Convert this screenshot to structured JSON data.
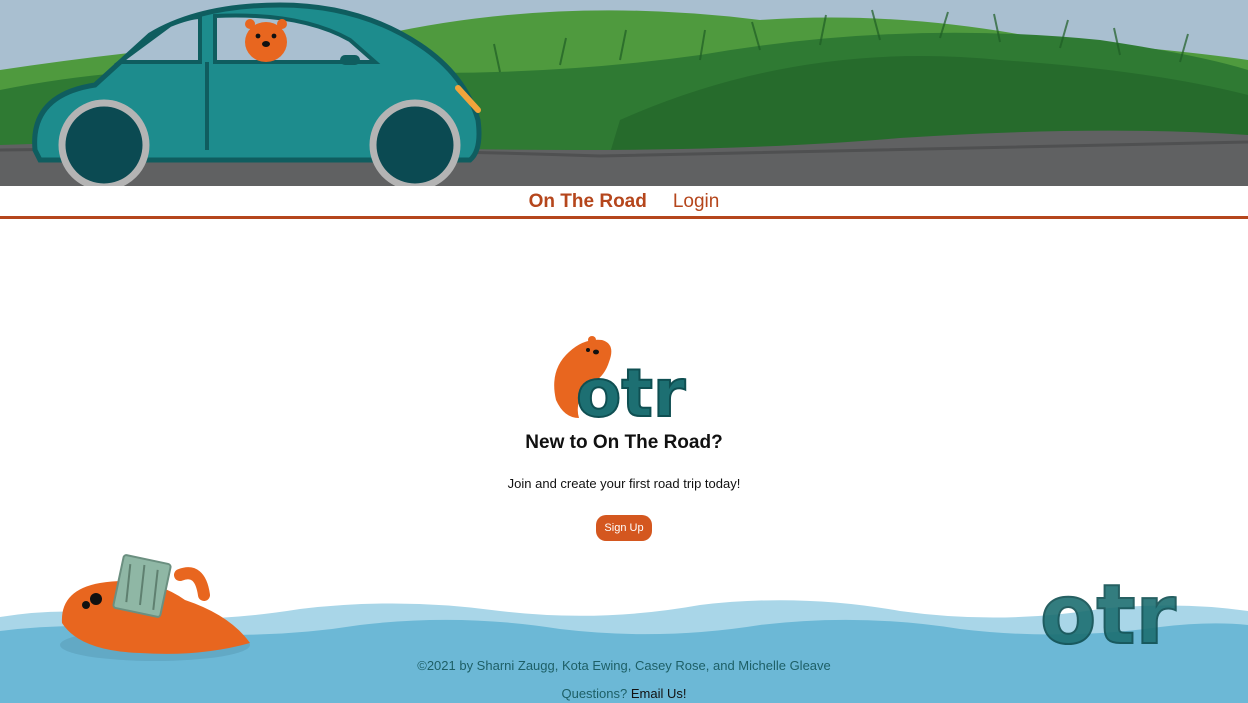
{
  "nav": {
    "brand": "On The Road",
    "login": "Login"
  },
  "logo": {
    "icon": "otter-otr-logo",
    "text": "otr"
  },
  "hero": {
    "headline": "New to On The Road?",
    "subtext": "Join and create your first road trip today!",
    "signup_label": "Sign Up"
  },
  "footer": {
    "credits": "©2021 by Sharni Zaugg, Kota Ewing, Casey Rose, and Michelle Gleave",
    "questions": "Questions?",
    "email_label": "Email Us!",
    "logo_text": "otr"
  },
  "colors": {
    "accent": "#b5461c",
    "button": "#d4571f",
    "teal": "#1d6f72",
    "otter": "#e8661f",
    "water": "#6cb8d6",
    "grass": "#3f8c3a",
    "road": "#5f6061"
  }
}
